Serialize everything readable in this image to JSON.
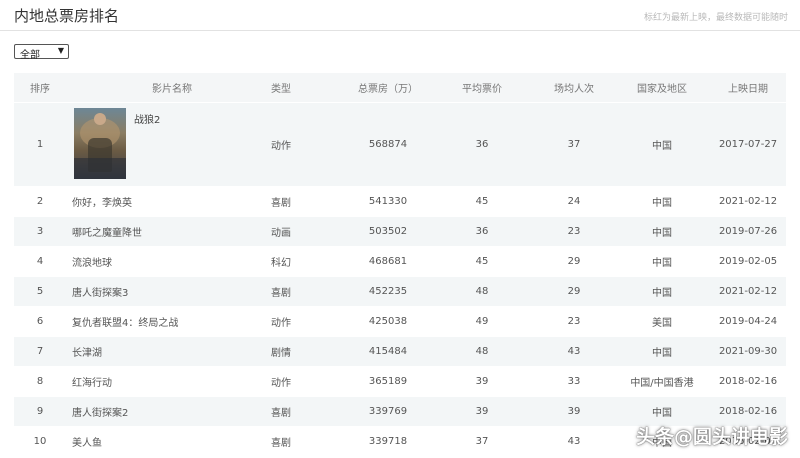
{
  "header": {
    "title": "内地总票房排名",
    "note": "标红为最新上映，最终数据可能随时"
  },
  "filter": {
    "selected": "全部"
  },
  "table": {
    "columns": [
      "排序",
      "影片名称",
      "类型",
      "总票房（万）",
      "平均票价",
      "场均人次",
      "国家及地区",
      "上映日期"
    ],
    "rows": [
      {
        "rank": "1",
        "name": "战狼2",
        "type": "动作",
        "box": "568874",
        "price": "36",
        "per_show": "37",
        "region": "中国",
        "date": "2017-07-27"
      },
      {
        "rank": "2",
        "name": "你好，李焕英",
        "type": "喜剧",
        "box": "541330",
        "price": "45",
        "per_show": "24",
        "region": "中国",
        "date": "2021-02-12"
      },
      {
        "rank": "3",
        "name": "哪吒之魔童降世",
        "type": "动画",
        "box": "503502",
        "price": "36",
        "per_show": "23",
        "region": "中国",
        "date": "2019-07-26"
      },
      {
        "rank": "4",
        "name": "流浪地球",
        "type": "科幻",
        "box": "468681",
        "price": "45",
        "per_show": "29",
        "region": "中国",
        "date": "2019-02-05"
      },
      {
        "rank": "5",
        "name": "唐人街探案3",
        "type": "喜剧",
        "box": "452235",
        "price": "48",
        "per_show": "29",
        "region": "中国",
        "date": "2021-02-12"
      },
      {
        "rank": "6",
        "name": "复仇者联盟4：终局之战",
        "type": "动作",
        "box": "425038",
        "price": "49",
        "per_show": "23",
        "region": "美国",
        "date": "2019-04-24"
      },
      {
        "rank": "7",
        "name": "长津湖",
        "type": "剧情",
        "box": "415484",
        "price": "48",
        "per_show": "43",
        "region": "中国",
        "date": "2021-09-30"
      },
      {
        "rank": "8",
        "name": "红海行动",
        "type": "动作",
        "box": "365189",
        "price": "39",
        "per_show": "33",
        "region": "中国/中国香港",
        "date": "2018-02-16"
      },
      {
        "rank": "9",
        "name": "唐人街探案2",
        "type": "喜剧",
        "box": "339769",
        "price": "39",
        "per_show": "39",
        "region": "中国",
        "date": "2018-02-16"
      },
      {
        "rank": "10",
        "name": "美人鱼",
        "type": "喜剧",
        "box": "339718",
        "price": "37",
        "per_show": "43",
        "region": "中国",
        "date": "2016-02-08"
      }
    ]
  },
  "watermark": "头条@圆头讲电影"
}
